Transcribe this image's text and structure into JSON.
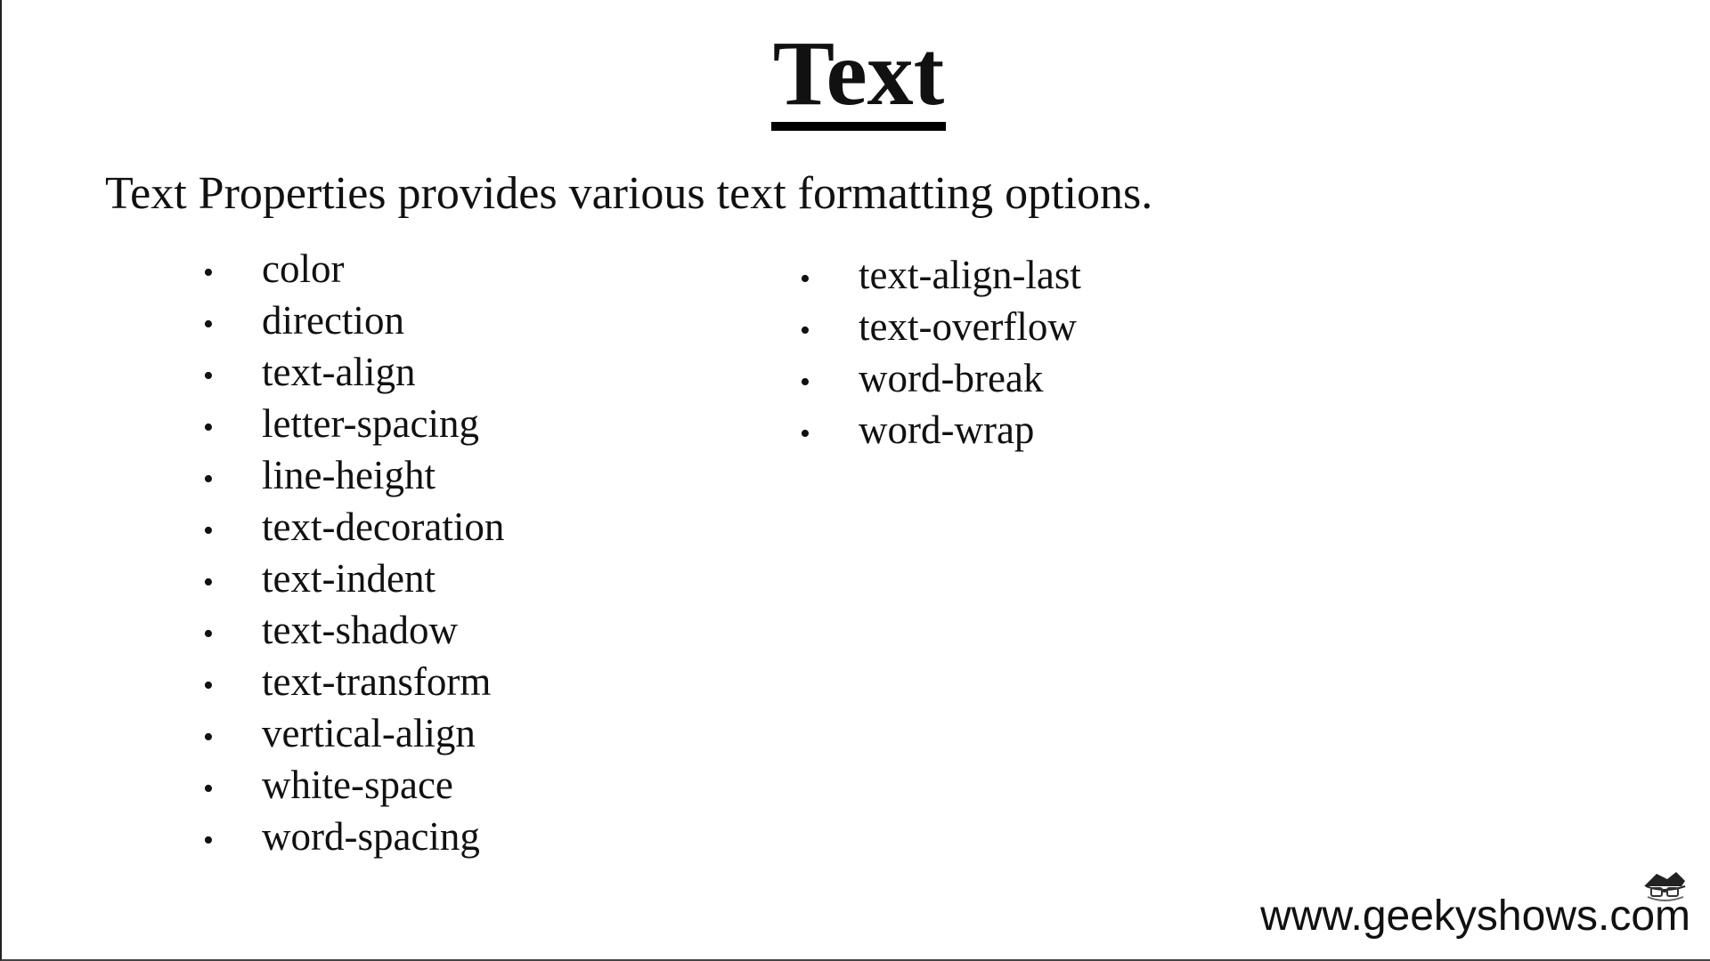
{
  "slide": {
    "title": "Text",
    "intro": "Text Properties provides various text formatting options.",
    "bullet_symbol": "•",
    "left_items": [
      "color",
      "direction",
      "text-align",
      "letter-spacing",
      "line-height",
      "text-decoration",
      "text-indent",
      "text-shadow",
      "text-transform",
      "vertical-align",
      "white-space",
      "word-spacing"
    ],
    "right_items": [
      "text-align-last",
      "text-overflow",
      "word-break",
      "word-wrap"
    ],
    "footer_url": "www.geekyshows.com",
    "logo_icon": "geek-mascot-icon"
  }
}
